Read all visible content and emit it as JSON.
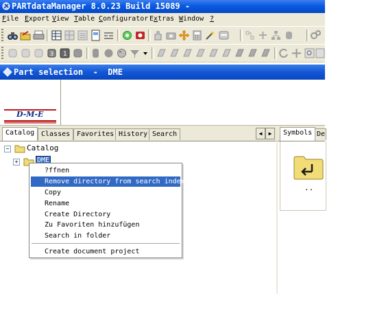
{
  "window": {
    "title": "PARTdataManager 8.0.23 Build 15089 -",
    "icon": "partdatamanager-app-icon"
  },
  "menu": [
    {
      "prefix": "",
      "u": "F",
      "rest": "ile"
    },
    {
      "prefix": "",
      "u": "E",
      "rest": "xport"
    },
    {
      "prefix": "",
      "u": "V",
      "rest": "iew"
    },
    {
      "prefix": "",
      "u": "T",
      "rest": "able"
    },
    {
      "prefix": "",
      "u": "C",
      "rest": "onfigurator"
    },
    {
      "prefix": "E",
      "u": "x",
      "rest": "tras"
    },
    {
      "prefix": "",
      "u": "W",
      "rest": "indow"
    },
    {
      "prefix": "",
      "u": "?",
      "rest": ""
    }
  ],
  "part_selection": {
    "title": "Part selection  -  DME",
    "logo_text": "D-M-E"
  },
  "tabs": {
    "left": [
      "Catalog",
      "Classes",
      "Favorites",
      "History",
      "Search"
    ],
    "right": [
      "Symbols",
      "De"
    ],
    "scroll_left": "◀",
    "scroll_right": "▶"
  },
  "tree": {
    "root": "Catalog",
    "child": "DME",
    "root_expander": "−",
    "child_expander": "+"
  },
  "context_menu": {
    "items": [
      "?ffnen",
      "Remove directory from search index",
      "Copy",
      "Rename",
      "Create Directory",
      "Zu Favoriten hinzufügen",
      "Search in folder",
      "Create document project"
    ],
    "highlighted": "Remove directory from search index"
  },
  "symbols": {
    "folder_label": ".."
  },
  "colors": {
    "title_blue": "#0a5ae0",
    "menu_bg": "#ece9d8",
    "highlight": "#316ac5",
    "folder_yellow": "#f1dc76"
  }
}
